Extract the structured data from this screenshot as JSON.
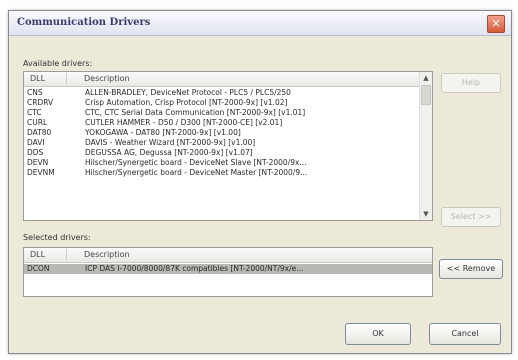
{
  "window": {
    "title": "Communication Drivers",
    "close_glyph": "×"
  },
  "available": {
    "label": "Available drivers:",
    "columns": [
      "DLL",
      "Description"
    ],
    "rows": [
      {
        "dll": "CNS",
        "desc": "ALLEN-BRADLEY, DeviceNet Protocol - PLC5 / PLC5/250"
      },
      {
        "dll": "CRDRV",
        "desc": "Crisp Automation, Crisp Protocol [NT-2000-9x] [v1.02]"
      },
      {
        "dll": "CTC",
        "desc": "CTC, CTC Serial Data Communication [NT-2000-9x] [v1.01]"
      },
      {
        "dll": "CURL",
        "desc": "CUTLER HAMMER - D50 / D300 [NT-2000-CE] [v2.01]"
      },
      {
        "dll": "DAT80",
        "desc": "YOKOGAWA - DAT80 [NT-2000-9x] [v1.00]"
      },
      {
        "dll": "DAVI",
        "desc": "DAVIS - Weather Wizard [NT-2000-9x] [v1.00]"
      },
      {
        "dll": "DDS",
        "desc": "DEGUSSA AG, Degussa [NT-2000-9x] [v1.07]"
      },
      {
        "dll": "DEVN",
        "desc": "Hilscher/Synergetic board - DeviceNet Slave [NT-2000/9x..."
      },
      {
        "dll": "DEVNM",
        "desc": "Hilscher/Synergetic board - DeviceNet Master [NT-2000/9..."
      }
    ],
    "edit_button": "Help",
    "select_button": "Select >>"
  },
  "selected": {
    "label": "Selected drivers:",
    "columns": [
      "DLL",
      "Description"
    ],
    "rows": [
      {
        "dll": "DCON",
        "desc": "ICP DAS I-7000/8000/87K compatibles [NT-2000/NT/9x/e..."
      }
    ],
    "remove_button": "<< Remove"
  },
  "buttons": {
    "ok": "OK",
    "cancel": "Cancel"
  }
}
